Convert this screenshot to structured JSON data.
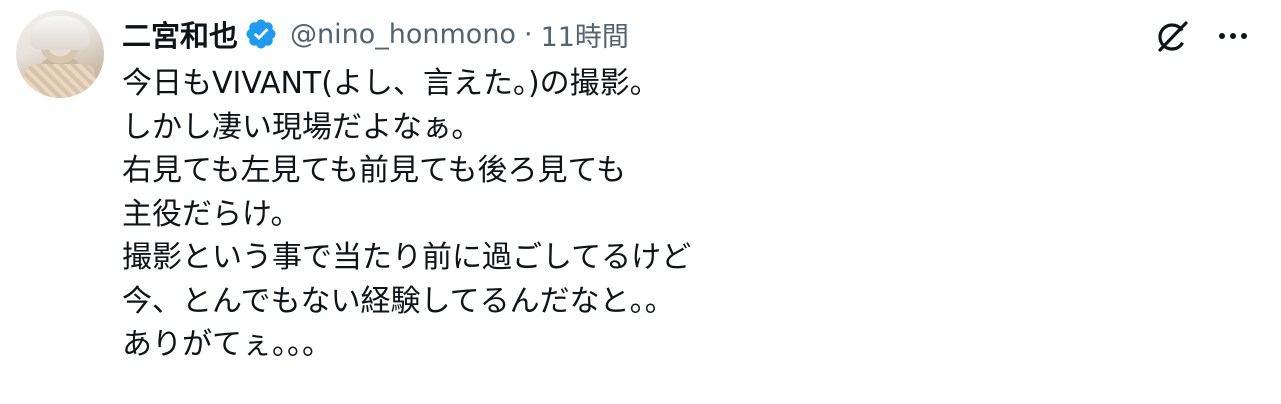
{
  "tweet": {
    "author": {
      "name": "二宮和也",
      "handle": "@nino_honmono",
      "verified": true
    },
    "separator": "·",
    "time": "11時間",
    "lines": [
      "今日もVIVANT(よし、言えた。)の撮影。",
      "しかし凄い現場だよなぁ。",
      "右見ても左見ても前見ても後ろ見ても",
      "主役だらけ。",
      "撮影という事で当たり前に過ごしてるけど",
      "今、とんでもない経験してるんだなと。。",
      "ありがてぇ。。。"
    ]
  },
  "icons": {
    "verified": "verified-badge-icon",
    "grok": "grok-icon",
    "more": "more-icon"
  },
  "colors": {
    "text": "#0f1419",
    "secondary": "#536471",
    "verified": "#1d9bf0"
  }
}
